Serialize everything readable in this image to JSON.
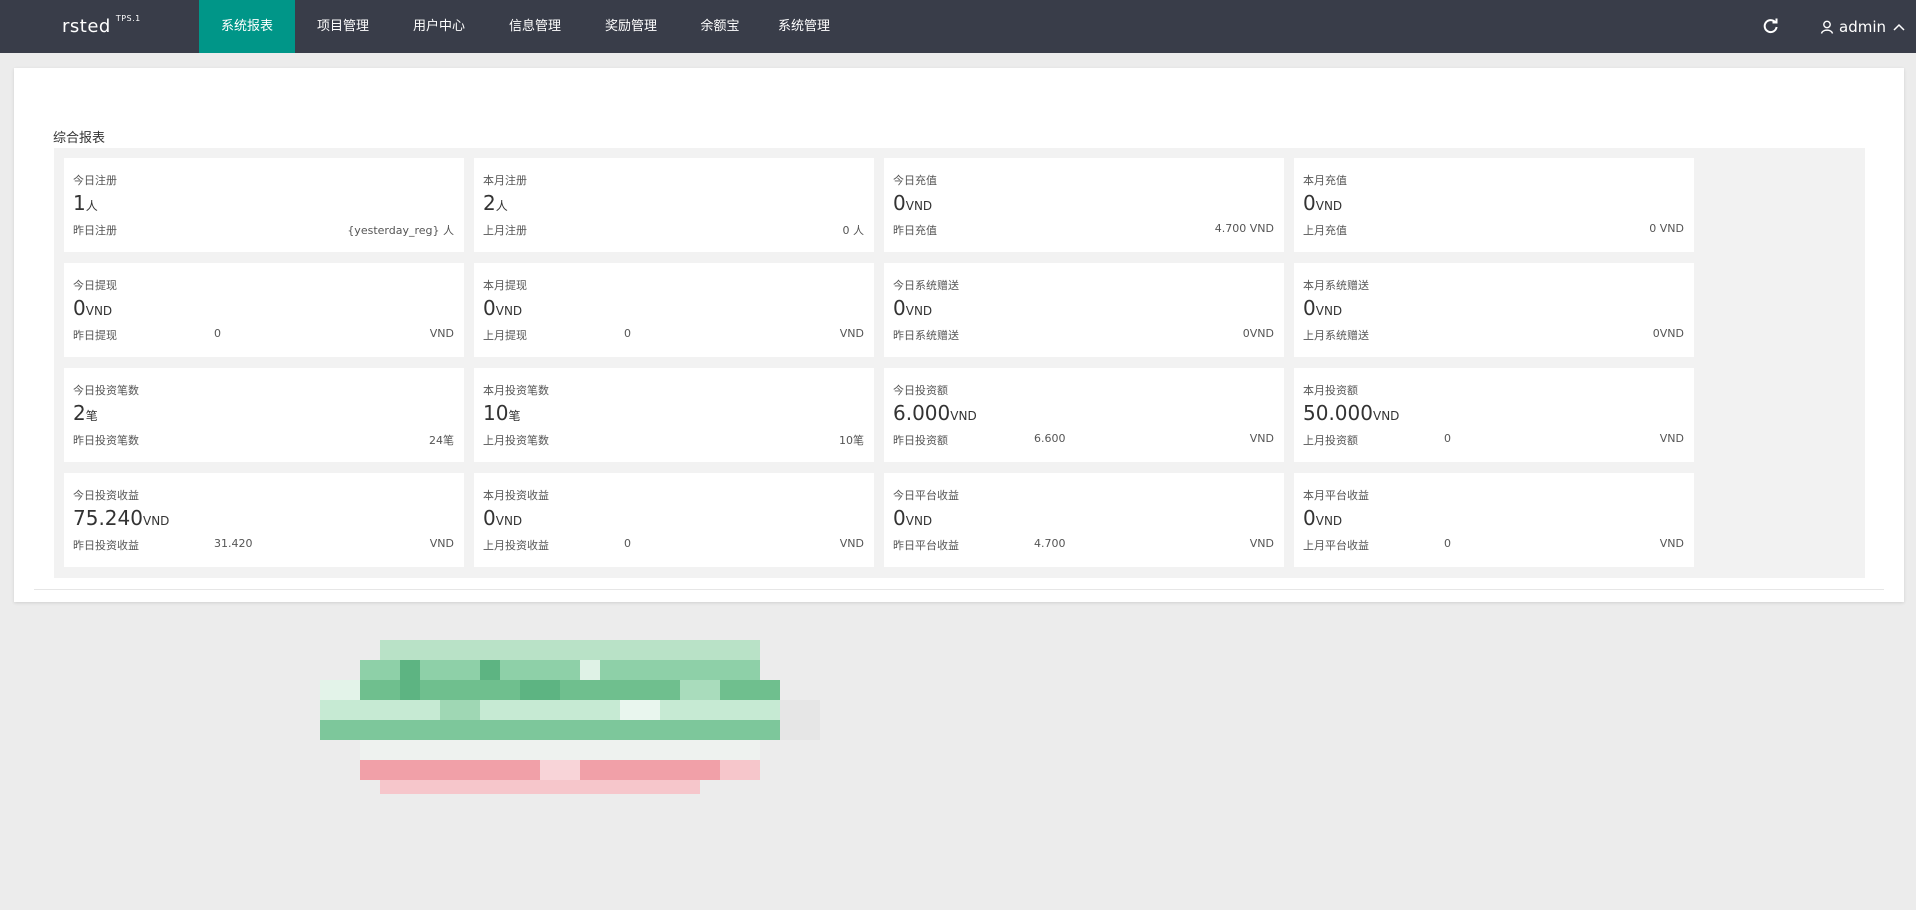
{
  "header": {
    "brand": "rsted",
    "version": "TPS.1",
    "nav": [
      {
        "label": "系统报表",
        "active": true
      },
      {
        "label": "项目管理",
        "active": false
      },
      {
        "label": "用户中心",
        "active": false
      },
      {
        "label": "信息管理",
        "active": false
      },
      {
        "label": "奖励管理",
        "active": false
      },
      {
        "label": "余额宝",
        "active": false
      },
      {
        "label": "系统管理",
        "active": false
      }
    ],
    "user": "admin"
  },
  "report": {
    "title": "综合报表",
    "rows": [
      [
        {
          "label": "今日注册",
          "value": "1",
          "unit": "人",
          "sub_label": "昨日注册",
          "sub_right": "{yesterday_reg} 人"
        },
        {
          "label": "本月注册",
          "value": "2",
          "unit": "人",
          "sub_label": "上月注册",
          "sub_right": "0 人"
        },
        {
          "label": "今日充值",
          "value": "0",
          "unit": "VND",
          "sub_label": "昨日充值",
          "sub_right": "4.700 VND"
        },
        {
          "label": "本月充值",
          "value": "0",
          "unit": "VND",
          "sub_label": "上月充值",
          "sub_right": "0 VND"
        }
      ],
      [
        {
          "label": "今日提现",
          "value": "0",
          "unit": "VND",
          "sub_label": "昨日提现",
          "sub_value": "0",
          "sub_unit": "VND"
        },
        {
          "label": "本月提现",
          "value": "0",
          "unit": "VND",
          "sub_label": "上月提现",
          "sub_value": "0",
          "sub_unit": "VND"
        },
        {
          "label": "今日系统赠送",
          "value": "0",
          "unit": "VND",
          "sub_label": "昨日系统赠送",
          "sub_right": "0VND"
        },
        {
          "label": "本月系统赠送",
          "value": "0",
          "unit": "VND",
          "sub_label": "上月系统赠送",
          "sub_right": "0VND"
        }
      ],
      [
        {
          "label": "今日投资笔数",
          "value": "2",
          "unit": "笔",
          "sub_label": "昨日投资笔数",
          "sub_right": "24笔"
        },
        {
          "label": "本月投资笔数",
          "value": "10",
          "unit": "笔",
          "sub_label": "上月投资笔数",
          "sub_right": "10笔"
        },
        {
          "label": "今日投资额",
          "value": "6.000",
          "unit": "VND",
          "sub_label": "昨日投资额",
          "sub_value": "6.600",
          "sub_unit": "VND"
        },
        {
          "label": "本月投资额",
          "value": "50.000",
          "unit": "VND",
          "sub_label": "上月投资额",
          "sub_value": "0",
          "sub_unit": "VND"
        }
      ],
      [
        {
          "label": "今日投资收益",
          "value": "75.240",
          "unit": "VND",
          "sub_label": "昨日投资收益",
          "sub_value": "31.420",
          "sub_unit": "VND"
        },
        {
          "label": "本月投资收益",
          "value": "0",
          "unit": "VND",
          "sub_label": "上月投资收益",
          "sub_value": "0",
          "sub_unit": "VND"
        },
        {
          "label": "今日平台收益",
          "value": "0",
          "unit": "VND",
          "sub_label": "昨日平台收益",
          "sub_value": "4.700",
          "sub_unit": "VND"
        },
        {
          "label": "本月平台收益",
          "value": "0",
          "unit": "VND",
          "sub_label": "上月平台收益",
          "sub_value": "0",
          "sub_unit": "VND"
        }
      ]
    ]
  },
  "colors": {
    "topbar": "#393d49",
    "accent": "#009688",
    "mosaic_green": "#6fbf8e",
    "mosaic_pink": "#f1a0a8"
  }
}
